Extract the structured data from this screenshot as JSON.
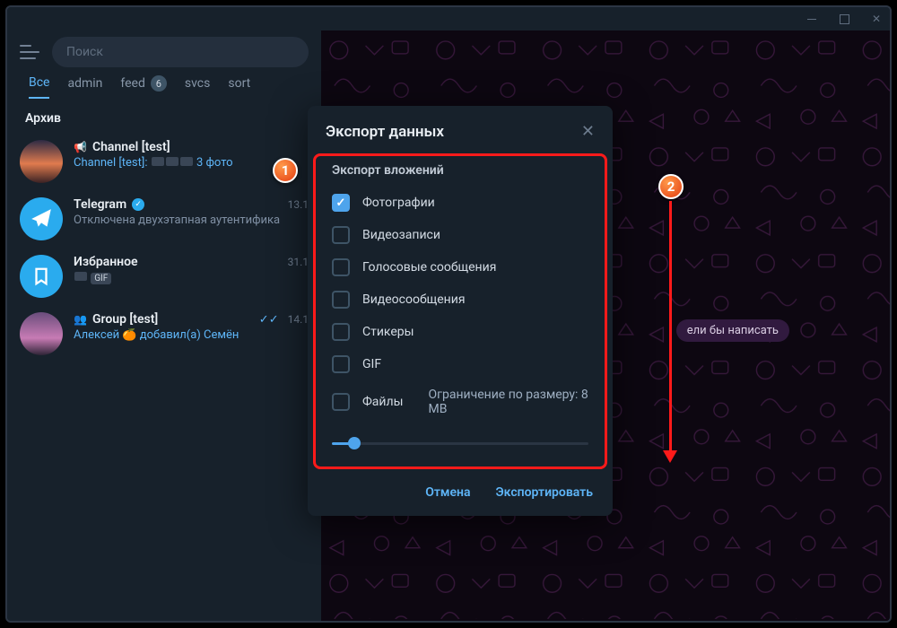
{
  "titlebar": {},
  "search": {
    "placeholder": "Поиск"
  },
  "tabs": [
    {
      "label": "Все",
      "active": true
    },
    {
      "label": "admin"
    },
    {
      "label": "feed",
      "badge": "6"
    },
    {
      "label": "svcs"
    },
    {
      "label": "sort"
    }
  ],
  "section": "Архив",
  "chats": [
    {
      "kind": "channel",
      "title": "Channel [test]",
      "sender": "Channel [test]:",
      "tail": "3 фото",
      "avatar": "sunset",
      "has_thumbs": true
    },
    {
      "kind": "service",
      "title": "Telegram",
      "verified": true,
      "time": "13.1",
      "sub": "Отключена двухэтапная аутентифика",
      "avatar": "plane"
    },
    {
      "kind": "saved",
      "title": "Избранное",
      "time": "31.1",
      "gif": "GIF",
      "avatar": "save"
    },
    {
      "kind": "group",
      "title": "Group [test]",
      "checks": true,
      "time": "14.1",
      "sub_prefix": "Алексей",
      "sub_emoji": "🍊",
      "sub_tail": "добавил(а) Семён",
      "avatar": "house"
    }
  ],
  "hint": "ели бы написать",
  "dialog": {
    "title": "Экспорт данных",
    "section": "Экспорт вложений",
    "options": [
      {
        "label": "Фотографии",
        "checked": true
      },
      {
        "label": "Видеозаписи",
        "checked": false
      },
      {
        "label": "Голосовые сообщения",
        "checked": false
      },
      {
        "label": "Видеосообщения",
        "checked": false
      },
      {
        "label": "Стикеры",
        "checked": false
      },
      {
        "label": "GIF",
        "checked": false
      },
      {
        "label": "Файлы",
        "checked": false,
        "extra": "Ограничение по размеру: 8 MB"
      }
    ],
    "cancel": "Отмена",
    "export": "Экспортировать"
  },
  "annotations": {
    "one": "1",
    "two": "2"
  }
}
